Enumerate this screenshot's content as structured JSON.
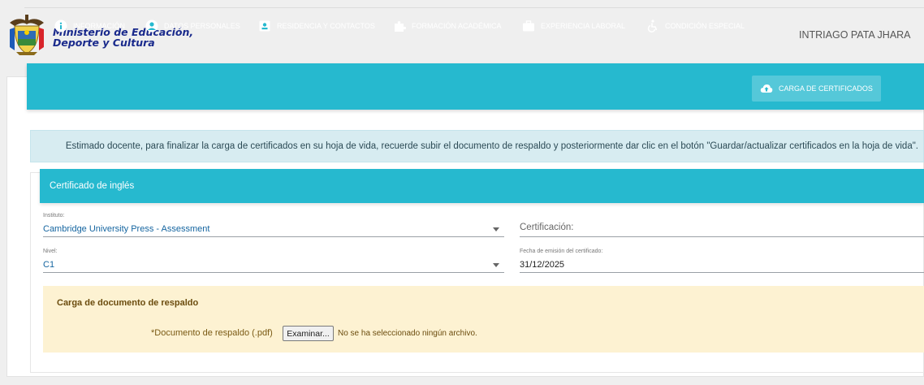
{
  "header": {
    "ministry_line1": "Ministerio de Educación,",
    "ministry_line2": "Deporte y Cultura",
    "user": "INTRIAGO PATA JHARA"
  },
  "tabs": [
    {
      "label": "INFORMACIÓN",
      "icon": "info-icon"
    },
    {
      "label": "DATOS PERSONALES",
      "icon": "user-circle-icon"
    },
    {
      "label": "RESIDENCIA Y CONTACTOS",
      "icon": "contact-card-icon"
    },
    {
      "label": "FORMACIÓN ACADÉMICA",
      "icon": "puzzle-icon"
    },
    {
      "label": "EXPERIENCIA LABORAL",
      "icon": "briefcase-icon"
    },
    {
      "label": "CONDICIÓN ESPECIAL",
      "icon": "wheelchair-icon"
    },
    {
      "label": "CARGA DE CERTIFICADOS",
      "icon": "cloud-upload-icon",
      "active": true
    }
  ],
  "alert": {
    "text": "Estimado docente, para finalizar la carga de certificados en su hoja de vida, recuerde subir el documento de respaldo y posteriormente dar clic en el botón \"Guardar/actualizar certificados en la hoja de vida\"."
  },
  "certificate": {
    "title": "Certificado de inglés",
    "institute_label": "Instituto:",
    "institute_value": "Cambridge University Press - Assessment",
    "certification_placeholder": "Certificación:",
    "level_label": "Nivel:",
    "level_value": "C1",
    "date_label": "Fecha de emisión del certificado:",
    "date_value": "31/12/2025"
  },
  "upload": {
    "title": "Carga de documento de respaldo",
    "file_label": "*Documento de respaldo (.pdf)",
    "button_label": "Examinar...",
    "status": "No se ha seleccionado ningún archivo."
  },
  "colors": {
    "accent": "#26b9cf",
    "ministry_text": "#1a2a8c",
    "alert_bg": "#d7ecf1",
    "upload_bg": "#fdf2d2"
  }
}
